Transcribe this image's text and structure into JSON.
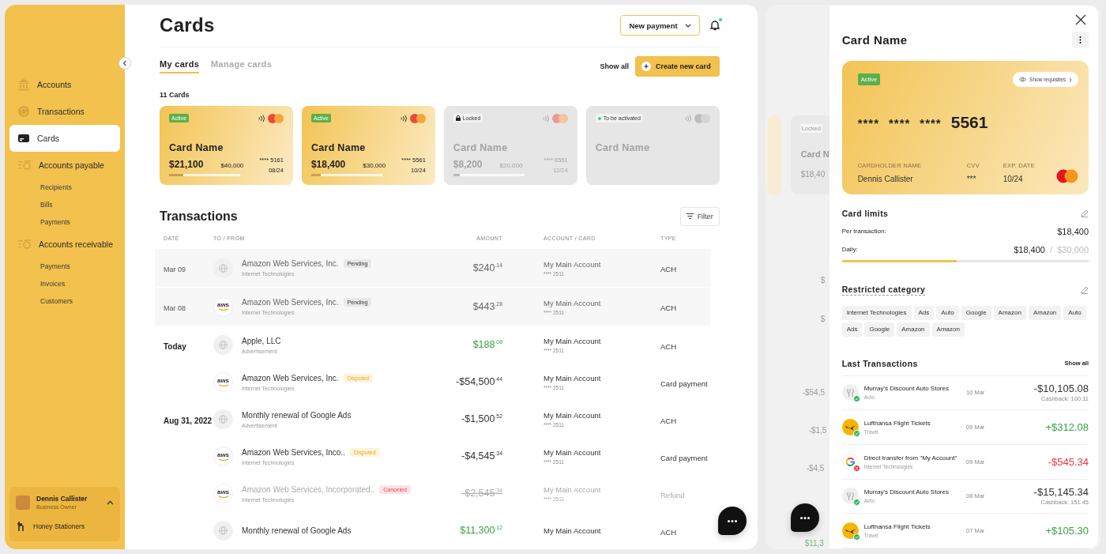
{
  "sidebar": {
    "nav": [
      {
        "label": "Accounts",
        "selected": false
      },
      {
        "label": "Transactions",
        "selected": false
      },
      {
        "label": "Cards",
        "selected": true
      },
      {
        "label": "Accounts payable",
        "selected": false,
        "children": [
          {
            "label": "Recipients",
            "selected": false
          },
          {
            "label": "Bills",
            "selected": false
          },
          {
            "label": "Payments",
            "selected": false
          }
        ]
      },
      {
        "label": "Accounts receivable",
        "selected": false,
        "children": [
          {
            "label": "Payments",
            "selected": false
          },
          {
            "label": "Invoices",
            "selected": false
          },
          {
            "label": "Customers",
            "selected": false
          }
        ]
      }
    ],
    "user": {
      "name": "Dennis Callister",
      "role": "Business Owner",
      "company": "Honey Stationers",
      "expanded": true
    }
  },
  "header": {
    "title": "Cards",
    "new_payment": "New payment",
    "unread": true
  },
  "tabs": [
    {
      "label": "My cards",
      "selected": true
    },
    {
      "label": "Manage cards",
      "selected": false
    }
  ],
  "show_all": "Show all",
  "create_card": "Create new card",
  "cards_count": "11 Cards",
  "cards": [
    {
      "kind": "active",
      "status": "Active",
      "name": "Card Name",
      "balance": "$21,100",
      "limit": "$40,000",
      "number": "**** 5161",
      "expiry": "08/24",
      "level": 0.2
    },
    {
      "kind": "active",
      "status": "Active",
      "name": "Card Name",
      "balance": "$18,400",
      "limit": "$30,000",
      "number": "**** 5561",
      "expiry": "10/24",
      "level": 0.13
    },
    {
      "kind": "locked",
      "status": "Locked",
      "name": "Card Name",
      "balance": "$8,200",
      "limit": "$20,000",
      "number": "**** 6551",
      "expiry": "12/24",
      "level": 0.09
    },
    {
      "kind": "pending",
      "status": "To be activated",
      "name": "Card Name"
    }
  ],
  "transactions": {
    "title": "Transactions",
    "filter": "Filter",
    "columns": [
      "DATE",
      "TO / FROM",
      "AMOUNT",
      "ACCOUNT / CARD",
      "TYPE"
    ],
    "rows": [
      {
        "date": "Mar 09",
        "shaded": true,
        "name": "Amazon Web Services, Inc.",
        "category": "Internet Technologies",
        "badge": {
          "label": "Pending",
          "kind": "pending"
        },
        "amount": "$240$^{.14}$",
        "kind": "pending",
        "account": "My Main Account",
        "account_number": "**** 2511",
        "type": "ACH"
      },
      {
        "date": "Mar 08",
        "shaded": true,
        "logo_text": "aws",
        "name": "Amazon Web Services, Inc.",
        "category": "Internet Technologies",
        "badge": {
          "label": "Pending",
          "kind": "pending"
        },
        "amount": "$443$^{.28}$",
        "kind": "pending",
        "account": "My Main Account",
        "account_number": "**** 2511",
        "type": "ACH"
      },
      {
        "date": "Today",
        "shaded": false,
        "name": "Apple, LLC",
        "category": "Advertisement",
        "amount": "$188$^{.08}$",
        "kind": "incoming",
        "account": "My Main Account",
        "account_number": "**** 2511",
        "type": "ACH"
      },
      {
        "shaded": false,
        "logo_text": "aws",
        "name": "Amazon Web Services, Inc.",
        "category": "Internet Technologies",
        "badge": {
          "label": "Disputed",
          "kind": "disputed"
        },
        "amount": "-$54,500$^{.44}$",
        "kind": "outgoing",
        "account": "My Main Account",
        "account_number": "**** 2511",
        "type": "Card payment"
      },
      {
        "date": "Aug 31, 2022",
        "shaded": false,
        "name": "Monthly renewal of Google Ads",
        "category": "Advertisement",
        "amount": "-$1,500$^{.52}$",
        "kind": "outgoing",
        "account": "My Main Account",
        "account_number": "**** 2511",
        "type": "ACH"
      },
      {
        "shaded": false,
        "logo_text": "aws",
        "name": "Amazon Web Services, Inco..",
        "category": "Internet Technologies",
        "badge": {
          "label": "Disputed",
          "kind": "disputed"
        },
        "amount": "-$4,545$^{.34}$",
        "kind": "outgoing",
        "account": "My Main Account",
        "account_number": "**** 2511",
        "type": "Card payment"
      },
      {
        "shaded": false,
        "logo_text": "aws",
        "name": "Amazon Web Services, Incorporated..",
        "category": "Internet Technologies",
        "badge": {
          "label": "Canceled",
          "kind": "canceled"
        },
        "amount": "-$2,545$^{.34}$",
        "kind": "canceled",
        "account": "My Main Account",
        "account_number": "**** 2511",
        "type": "Refund"
      },
      {
        "shaded": false,
        "name": "Monthly renewal of Google Ads",
        "amount": "$11,300$^{.12}$",
        "kind": "incoming",
        "account": "My Main Account",
        "type": "ACH"
      }
    ]
  },
  "ghost": {
    "texts": [
      "Locked",
      "Card N",
      "$18,40",
      "$",
      "$",
      "-$54,5",
      "-$1,5",
      "-$4,5",
      "$11,3"
    ]
  },
  "drawer": {
    "title": "Card Name",
    "card": {
      "status": "Active",
      "show_requisites": "Show requisites",
      "number_groups": [
        "****",
        "****",
        "****"
      ],
      "last4": "5561",
      "holder_label": "CARDHOLDER NAME",
      "holder": "Dennis Callister",
      "cvv_label": "CVV",
      "cvv": "***",
      "exp_label": "EXP. DATE",
      "exp": "10/24"
    },
    "limits": {
      "title": "Card limits",
      "per_transaction_label": "Per transaction:",
      "per_transaction": "$18,400",
      "daily_label": "Daily:",
      "daily_spent": "$18,400",
      "separator": "/",
      "daily_limit": "$30,000",
      "level": 0.465
    },
    "restricted": {
      "title": "Restricted category",
      "tags": [
        "Internet Technologies",
        "Ads",
        "Auto",
        "Google",
        "Amazon",
        "Amazon",
        "Auto",
        "Ads",
        "Google",
        "Amazon",
        "Amazon"
      ]
    },
    "last": {
      "title": "Last Transactions",
      "show_all": "Show all",
      "items": [
        {
          "kind": "auto",
          "name": "Murray's Discount Auto Stores",
          "category": "Auto",
          "date": "10 Mar",
          "amount": "-$10,105.08",
          "cashback": "Cashback: 100.11",
          "incoming": false,
          "failed": false
        },
        {
          "kind": "travel",
          "name": "Lufthansa Flight Tickets",
          "category": "Travel",
          "date": "09 Mar",
          "amount": "+$312.08",
          "incoming": true,
          "failed": false
        },
        {
          "kind": "transfer",
          "name": "Direct transfer from \"My Account\"",
          "category": "Internet Technologies",
          "date": "09 Mar",
          "amount": "-$545.34",
          "incoming": false,
          "failed": true
        },
        {
          "kind": "auto",
          "name": "Murray's Discount Auto Stores",
          "category": "Auto",
          "date": "08 Mar",
          "amount": "-$15,145.34",
          "cashback": "Cashback: 151.45",
          "incoming": false,
          "failed": false
        },
        {
          "kind": "travel",
          "name": "Lufthansa Flight Tickets",
          "category": "Travel",
          "date": "07 Mar",
          "amount": "+$105.30",
          "incoming": true,
          "failed": false
        }
      ]
    }
  }
}
